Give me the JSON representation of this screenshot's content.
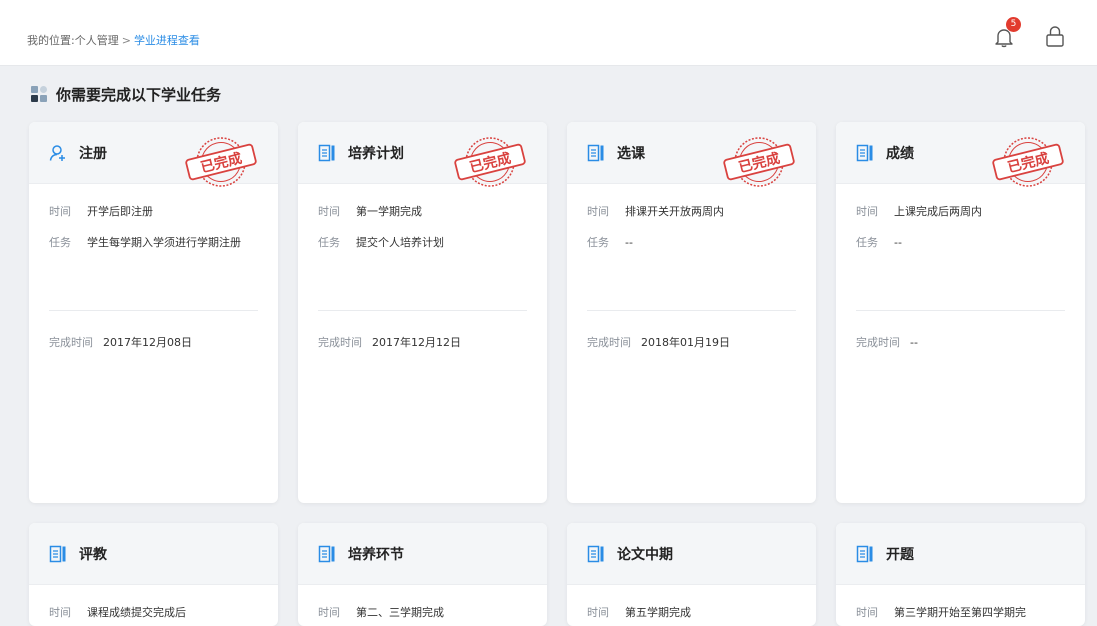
{
  "breadcrumb": {
    "prefix": "我的位置:",
    "item1": "个人管理",
    "separator": ">",
    "current": "学业进程查看"
  },
  "header": {
    "notification_count": "5",
    "bell_icon": "bell-icon",
    "lock_icon": "lock-icon"
  },
  "section": {
    "title": "你需要完成以下学业任务"
  },
  "labels": {
    "time": "时间",
    "task": "任务",
    "done_time": "完成时间"
  },
  "stamp_text": "已完成",
  "colors": {
    "accent": "#2a8ce5",
    "stamp": "#d9423f",
    "badge": "#e23b2e"
  },
  "cards": [
    {
      "title": "注册",
      "icon": "user-add-icon",
      "time": "开学后即注册",
      "task": "学生每学期入学须进行学期注册",
      "done_time": "2017年12月08日",
      "completed": true
    },
    {
      "title": "培养计划",
      "icon": "document-icon",
      "time": "第一学期完成",
      "task": "提交个人培养计划",
      "done_time": "2017年12月12日",
      "completed": true
    },
    {
      "title": "选课",
      "icon": "document-icon",
      "time": "排课开关开放两周内",
      "task": "--",
      "done_time": "2018年01月19日",
      "completed": true
    },
    {
      "title": "成绩",
      "icon": "document-icon",
      "time": "上课完成后两周内",
      "task": "--",
      "done_time": "--",
      "completed": true
    },
    {
      "title": "评教",
      "icon": "document-icon",
      "time": "课程成绩提交完成后"
    },
    {
      "title": "培养环节",
      "icon": "document-icon",
      "time": "第二、三学期完成"
    },
    {
      "title": "论文中期",
      "icon": "document-icon",
      "time": "第五学期完成"
    },
    {
      "title": "开题",
      "icon": "document-icon",
      "time": "第三学期开始至第四学期完"
    }
  ]
}
